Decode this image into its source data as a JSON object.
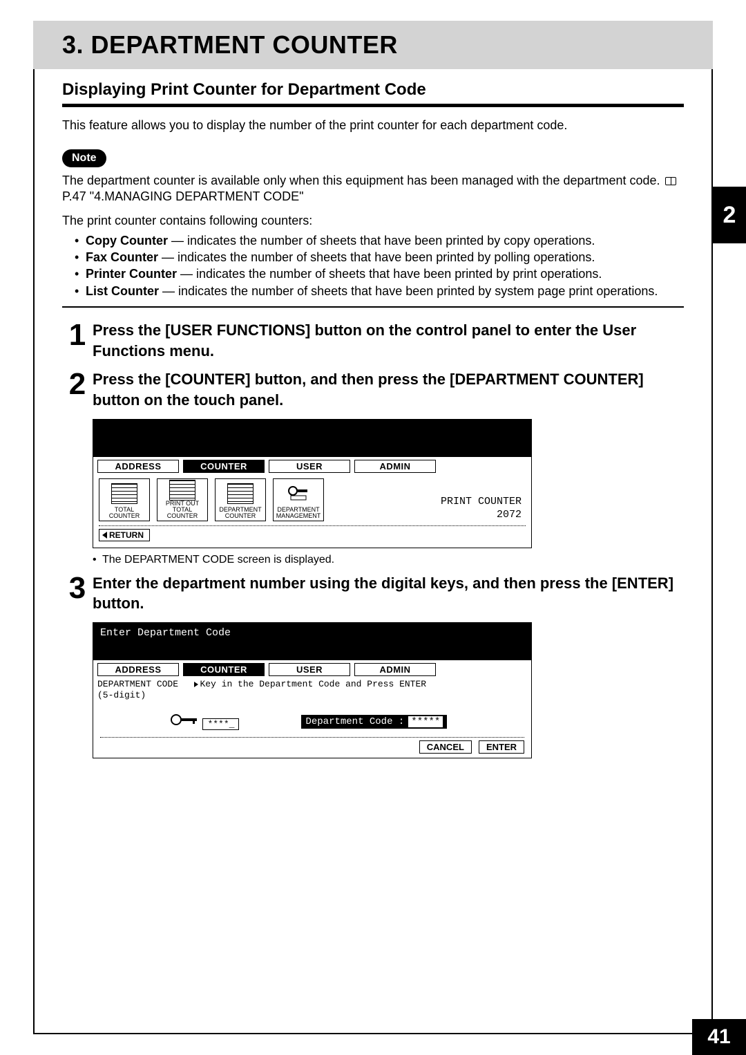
{
  "title": "3. DEPARTMENT COUNTER",
  "subtitle": "Displaying Print Counter for Department Code",
  "intro": "This feature allows you to display the number of the print counter for each department code.",
  "note_label": "Note",
  "note_text_a": "The department counter is available only when this equipment has been managed with the department code. ",
  "note_text_b": " P.47 \"4.MANAGING DEPARTMENT CODE\"",
  "counter_intro": "The print counter contains following counters:",
  "counters": [
    {
      "name": "Copy Counter",
      "desc": " — indicates the number of sheets that have been printed by copy operations."
    },
    {
      "name": "Fax Counter",
      "desc": " — indicates the number of sheets that have been printed by polling operations."
    },
    {
      "name": "Printer Counter",
      "desc": " — indicates the number of sheets that have been printed by print operations."
    },
    {
      "name": "List Counter",
      "desc": " — indicates the number of sheets that have been printed by system page print operations."
    }
  ],
  "steps": {
    "s1": {
      "num": "1",
      "text": "Press the [USER FUNCTIONS] button on the control panel to enter the User Functions menu."
    },
    "s2": {
      "num": "2",
      "text": "Press the [COUNTER] button, and then press the [DEPARTMENT COUNTER] button on the touch panel.",
      "sub": "The DEPARTMENT CODE screen is displayed."
    },
    "s3": {
      "num": "3",
      "text": "Enter the department number using the digital keys, and then press the [ENTER] button."
    }
  },
  "screen1": {
    "tabs": [
      "ADDRESS",
      "COUNTER",
      "USER",
      "ADMIN"
    ],
    "fn": [
      "TOTAL COUNTER",
      "PRINT OUT TOTAL COUNTER",
      "DEPARTMENT COUNTER",
      "DEPARTMENT MANAGEMENT"
    ],
    "print_counter_label": "PRINT COUNTER",
    "print_counter_value": "2072",
    "return": "RETURN"
  },
  "screen2": {
    "top_text": "Enter Department Code",
    "tabs": [
      "ADDRESS",
      "COUNTER",
      "USER",
      "ADMIN"
    ],
    "dept_hint_a": "DEPARTMENT CODE",
    "dept_hint_b": "Key in the Department Code and Press ENTER",
    "dept_hint_c": "(5-digit)",
    "stars_small": "****_",
    "dept_code_label": "Department Code :",
    "stars_big": "*****",
    "cancel": "CANCEL",
    "enter": "ENTER"
  },
  "side_tab": "2",
  "page_number": "41"
}
